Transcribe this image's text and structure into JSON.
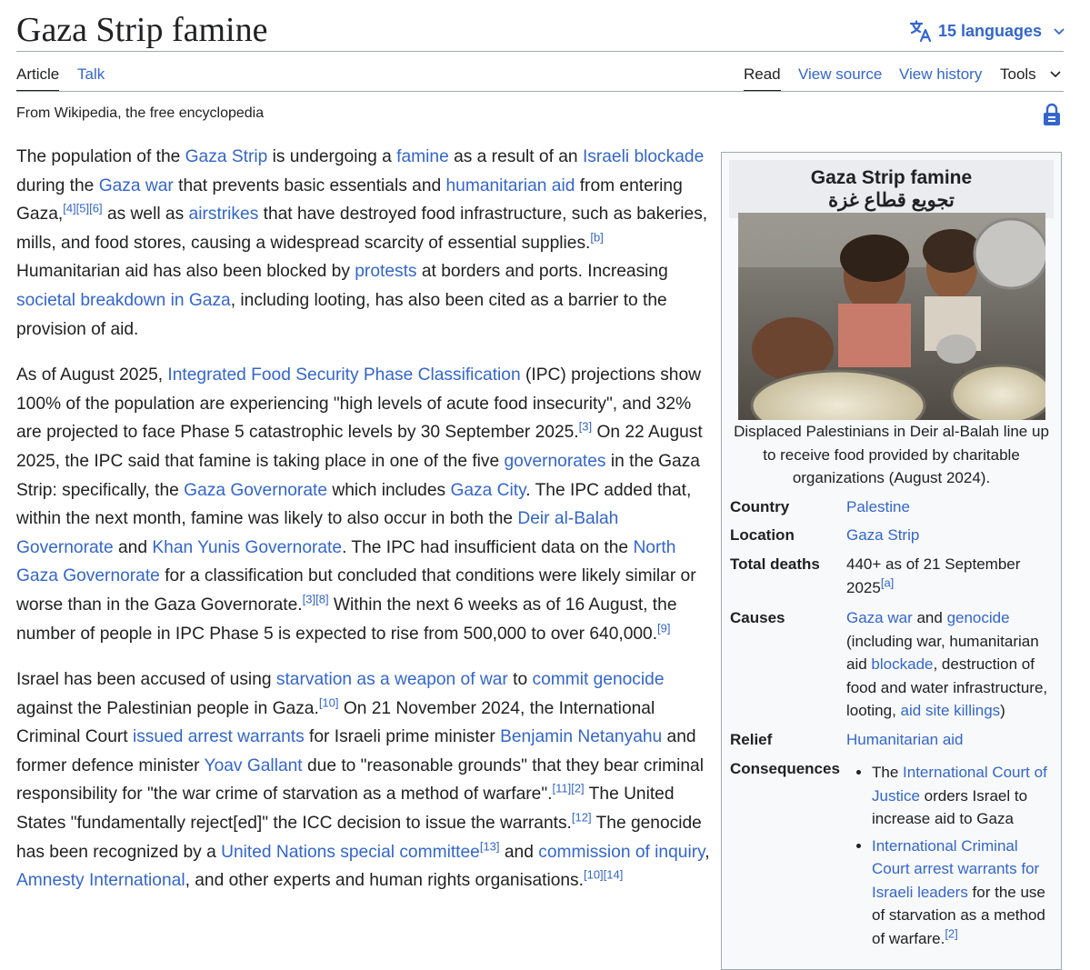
{
  "header": {
    "title": "Gaza Strip famine",
    "languages_label": "15 languages"
  },
  "tabs": {
    "article": "Article",
    "talk": "Talk",
    "read": "Read",
    "view_source": "View source",
    "view_history": "View history",
    "tools": "Tools"
  },
  "tagline": "From Wikipedia, the free encyclopedia",
  "infobox": {
    "title": "Gaza Strip famine",
    "subtitle": "تجويع قطاع غزة",
    "caption": "Displaced Palestinians in Deir al-Balah line up to receive food provided by charitable organizations (August 2024).",
    "country_label": "Country",
    "country_value": "Palestine",
    "location_label": "Location",
    "location_value": "Gaza Strip",
    "deaths_label": "Total deaths",
    "deaths_value": "440+ as of 21 September 2025",
    "deaths_ref": "[a]",
    "causes_label": "Causes",
    "causes": {
      "l1": "Gaza war",
      "t1": " and ",
      "l2": "genocide",
      "t2": " (including war, humanitarian aid ",
      "l3": "blockade",
      "t3": ", destruction of food and water infrastructure, looting, ",
      "l4": "aid site killings",
      "t4": ")"
    },
    "relief_label": "Relief",
    "relief_value": "Humanitarian aid",
    "consequences_label": "Consequences",
    "consequences": {
      "c1_t1": "The ",
      "c1_l1": "International Court of Justice",
      "c1_t2": " orders Israel to increase aid to Gaza",
      "c2_l1": "International Criminal Court arrest warrants for Israeli leaders",
      "c2_t1": " for the use of starvation as a method of warfare.",
      "c2_ref": "[2]"
    }
  },
  "paragraphs": {
    "p1": {
      "s1": "The population of the ",
      "l1": "Gaza Strip",
      "s2": " is undergoing a ",
      "l2": "famine",
      "s3": " as a result of an ",
      "l3": "Israeli blockade",
      "s4": " during the ",
      "l4": "Gaza war",
      "s5": " that prevents basic essentials and ",
      "l5": "humanitarian aid",
      "s6": " from entering Gaza,",
      "r1": "[4]",
      "r2": "[5]",
      "r3": "[6]",
      "s7": " as well as ",
      "l6": "airstrikes",
      "s8": " that have destroyed food infrastructure, such as bakeries, mills, and food stores, causing a widespread scarcity of essential supplies.",
      "r4": "[b]",
      "s9": " Humanitarian aid has also been blocked by ",
      "l7": "protests",
      "s10": " at borders and ports. Increasing ",
      "l8": "societal breakdown in Gaza",
      "s11": ", including looting, has also been cited as a barrier to the provision of aid."
    },
    "p2": {
      "s1": "As of August 2025, ",
      "l1": "Integrated Food Security Phase Classification",
      "s2": " (IPC) projections show 100% of the population are experiencing \"high levels of acute food insecurity\", and 32% are projected to face Phase 5 catastrophic levels by 30 September 2025.",
      "r1": "[3]",
      "s3": " On 22 August 2025, the IPC said that famine is taking place in one of the five ",
      "l2": "governorates",
      "s4": " in the Gaza Strip: specifically, the ",
      "l3": "Gaza Governorate",
      "s5": " which includes ",
      "l4": "Gaza City",
      "s6": ". The IPC added that, within the next month, famine was likely to also occur in both the ",
      "l5": "Deir al-Balah Governorate",
      "s7": " and ",
      "l6": "Khan Yunis Governorate",
      "s8": ". The IPC had insufficient data on the ",
      "l7": "North Gaza Governorate",
      "s9": " for a classification but concluded that conditions were likely similar or worse than in the Gaza Governorate.",
      "r2": "[3]",
      "r3": "[8]",
      "s10": " Within the next 6 weeks as of 16 August, the number of people in IPC Phase 5 is expected to rise from 500,000 to over 640,000.",
      "r4": "[9]"
    },
    "p3": {
      "s1": "Israel has been accused of using ",
      "l1": "starvation as a weapon of war",
      "s2": " to ",
      "l2": "commit genocide",
      "s3": " against the Palestinian people in Gaza.",
      "r1": "[10]",
      "s4": " On 21 November 2024, the International Criminal Court ",
      "l3": "issued arrest warrants",
      "s5": " for Israeli prime minister ",
      "l4": "Benjamin Netanyahu",
      "s6": " and former defence minister ",
      "l5": "Yoav Gallant",
      "s7": " due to \"reasonable grounds\" that they bear criminal responsibility for \"the war crime of starvation as a method of warfare\".",
      "r2": "[11]",
      "r3": "[2]",
      "s8": " The United States \"fundamentally reject[ed]\" the ICC decision to issue the warrants.",
      "r4": "[12]",
      "s9": " The genocide has been recognized by a ",
      "l6": "United Nations special committee",
      "r5": "[13]",
      "s10": " and ",
      "l7": "commission of inquiry",
      "s11": ", ",
      "l8": "Amnesty International",
      "s12": ", and other experts and human rights organisations.",
      "r6": "[10]",
      "r7": "[14]"
    }
  },
  "colors": {
    "link": "#3366cc",
    "text": "#202122",
    "rule": "#a2a9b1",
    "infobox_bg": "#f8f9fa",
    "infobox_head": "#eaecf0"
  },
  "icons": [
    "translate-icon",
    "chevron-down-icon",
    "lock-icon"
  ]
}
